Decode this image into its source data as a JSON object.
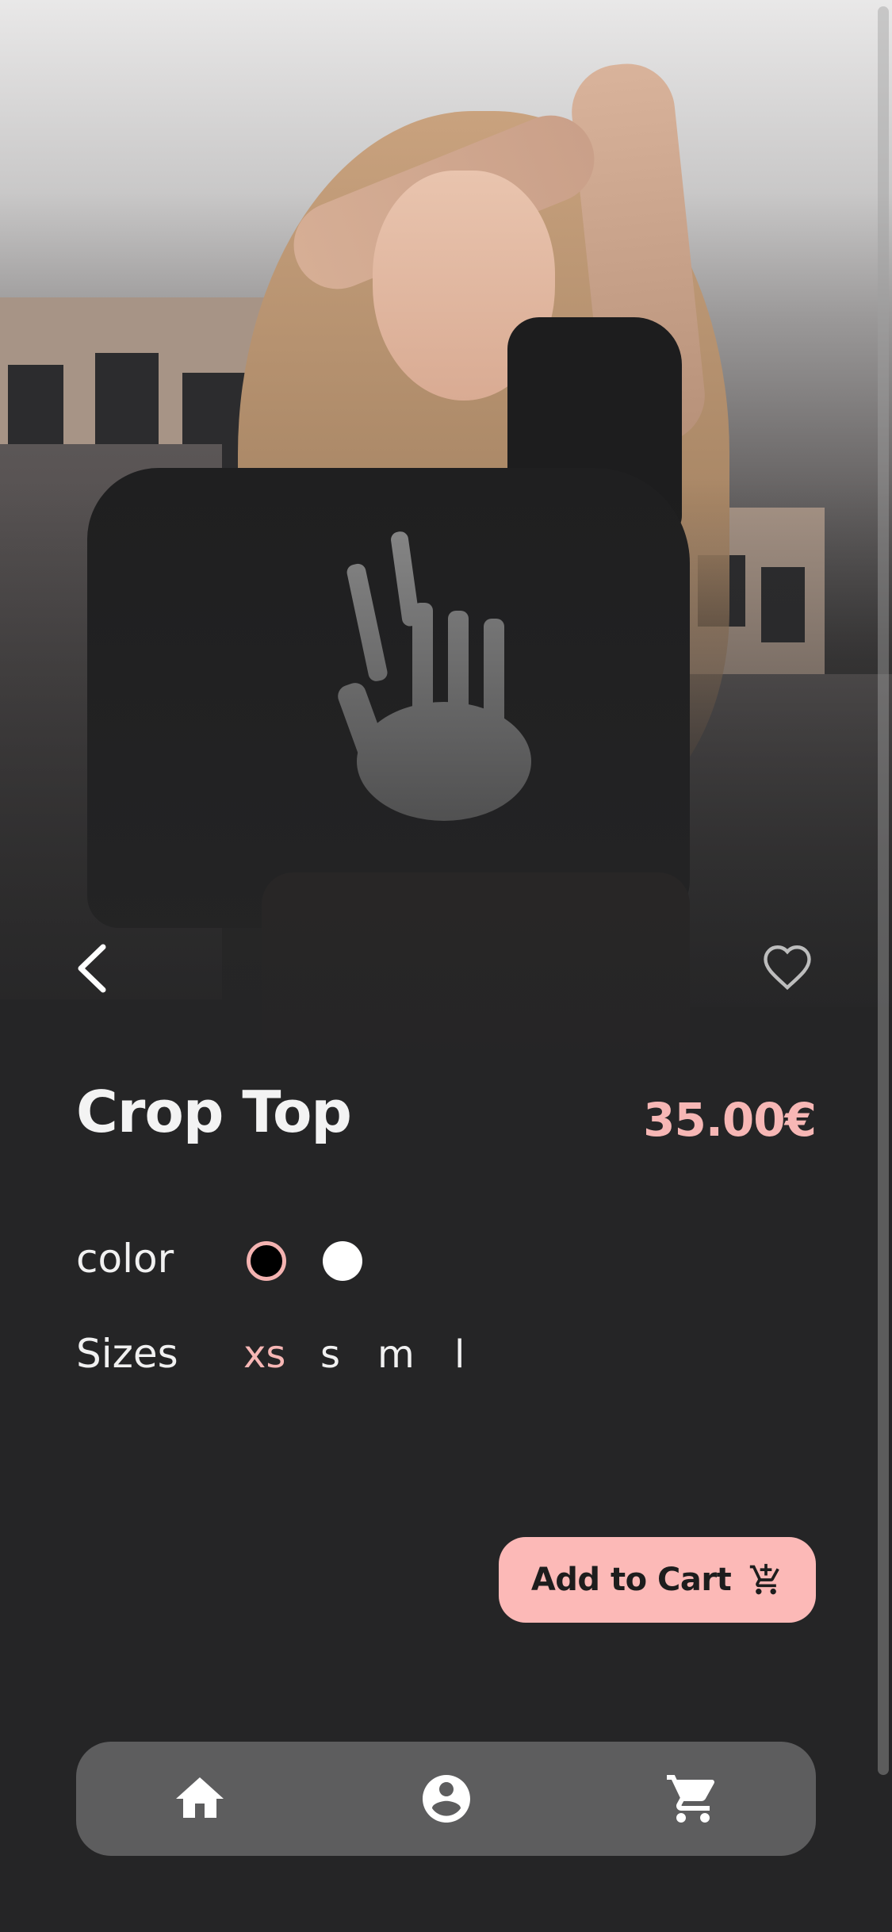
{
  "product": {
    "title": "Crop Top",
    "price": "35.00€"
  },
  "options": {
    "color_label": "color",
    "sizes_label": "Sizes",
    "colors": [
      {
        "name": "black",
        "hex": "#000000",
        "selected": true
      },
      {
        "name": "white",
        "hex": "#ffffff",
        "selected": false
      }
    ],
    "sizes": [
      {
        "label": "xs",
        "selected": true
      },
      {
        "label": "s",
        "selected": false
      },
      {
        "label": "m",
        "selected": false
      },
      {
        "label": "l",
        "selected": false
      }
    ]
  },
  "actions": {
    "add_to_cart_label": "Add to Cart"
  },
  "icons": {
    "back": "chevron-left-icon",
    "favorite": "heart-outline-icon",
    "add_to_cart": "cart-plus-icon",
    "home": "home-icon",
    "profile": "account-circle-icon",
    "cart": "shopping-cart-icon"
  },
  "colors": {
    "background": "#252526",
    "accent": "#f7b7b5",
    "button": "#fcb9b7",
    "nav_bar": "#5d5d5e",
    "text": "#f1f1f1"
  }
}
